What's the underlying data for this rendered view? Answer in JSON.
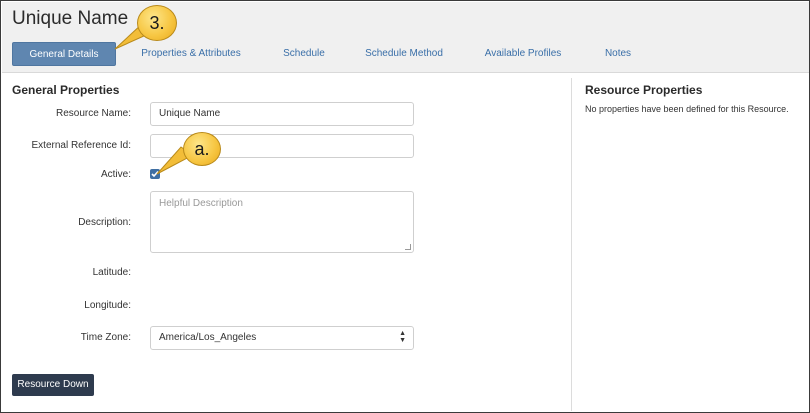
{
  "page": {
    "title": "Unique Name"
  },
  "tabs": [
    {
      "label": "General Details",
      "active": true
    },
    {
      "label": "Properties & Attributes",
      "active": false
    },
    {
      "label": "Schedule",
      "active": false
    },
    {
      "label": "Schedule Method",
      "active": false
    },
    {
      "label": "Available Profiles",
      "active": false
    },
    {
      "label": "Notes",
      "active": false
    }
  ],
  "general": {
    "section_title": "General Properties",
    "fields": {
      "resource_name": {
        "label": "Resource Name:",
        "value": "Unique Name"
      },
      "external_ref": {
        "label": "External Reference Id:",
        "value": ""
      },
      "active": {
        "label": "Active:",
        "checked": true
      },
      "description": {
        "label": "Description:",
        "placeholder": "Helpful Description"
      },
      "latitude": {
        "label": "Latitude:"
      },
      "longitude": {
        "label": "Longitude:"
      },
      "time_zone": {
        "label": "Time Zone:",
        "value": "America/Los_Angeles"
      }
    },
    "resource_down_label": "Resource Down"
  },
  "resource_properties": {
    "title": "Resource Properties",
    "empty_text": "No properties have been defined for this Resource."
  },
  "callouts": {
    "step": "3.",
    "field": "a."
  },
  "colors": {
    "accent": "#5f86b0",
    "link": "#3a6fa8",
    "callout": "#f7c744",
    "dark_button": "#2e3b4e"
  }
}
